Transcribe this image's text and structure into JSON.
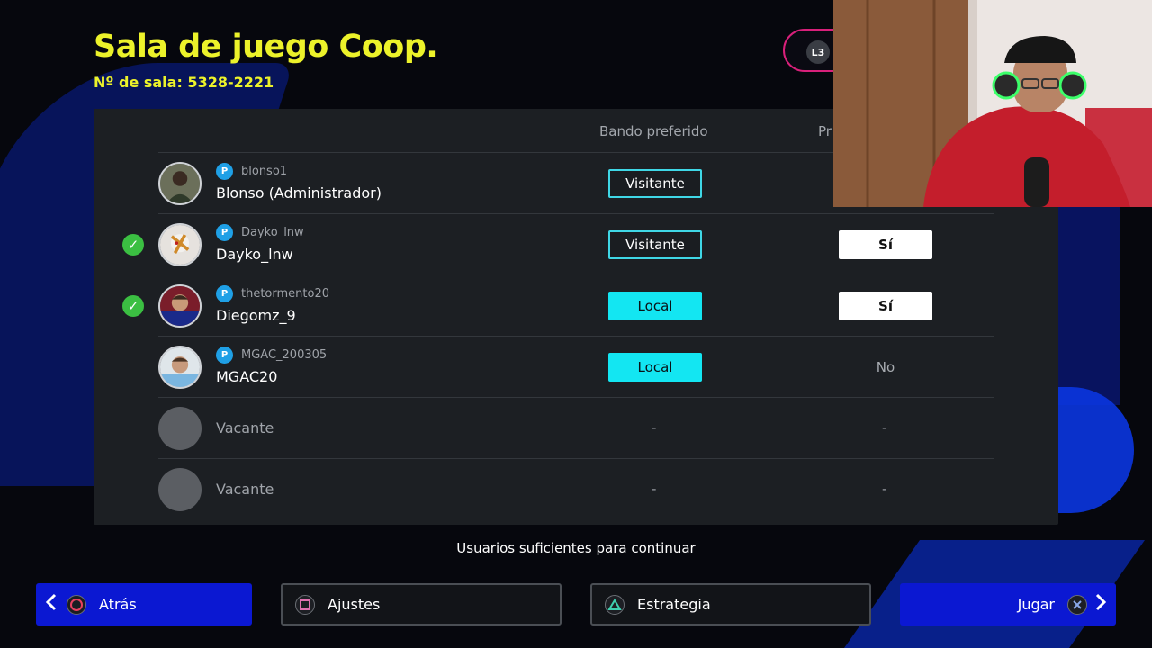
{
  "header": {
    "title": "Sala de juego Coop.",
    "room_number": "Nº de sala: 5328-2221",
    "l3_label": "L3"
  },
  "table": {
    "columns": {
      "side": "Bando preferido",
      "pref": "Pr"
    },
    "rows": [
      {
        "psn_id": "blonso1",
        "name": "Blonso (Administrador)",
        "ready": false,
        "side": "Visitante",
        "pref": ""
      },
      {
        "psn_id": "Dayko_lnw",
        "name": "Dayko_lnw",
        "ready": true,
        "side": "Visitante",
        "pref": "Sí"
      },
      {
        "psn_id": "thetormento20",
        "name": "Diegomz_9",
        "ready": true,
        "side": "Local",
        "pref": "Sí"
      },
      {
        "psn_id": "MGAC_200305",
        "name": "MGAC20",
        "ready": false,
        "side": "Local",
        "pref": "No"
      },
      {
        "name": "Vacante",
        "side": "-",
        "pref": "-"
      },
      {
        "name": "Vacante",
        "side": "-",
        "pref": "-"
      }
    ],
    "psn_glyph": "P"
  },
  "status_text": "Usuarios suficientes para continuar",
  "buttons": {
    "back": "Atrás",
    "settings": "Ajustes",
    "strategy": "Estrategia",
    "play": "Jugar"
  },
  "check_glyph": "✓",
  "colors": {
    "title_yellow": "#ecf22a",
    "accent_cyan": "#13e6f2",
    "primary_blue": "#0b18d2",
    "ready_green": "#3bbf42",
    "pill_magenta": "#d8207a"
  }
}
